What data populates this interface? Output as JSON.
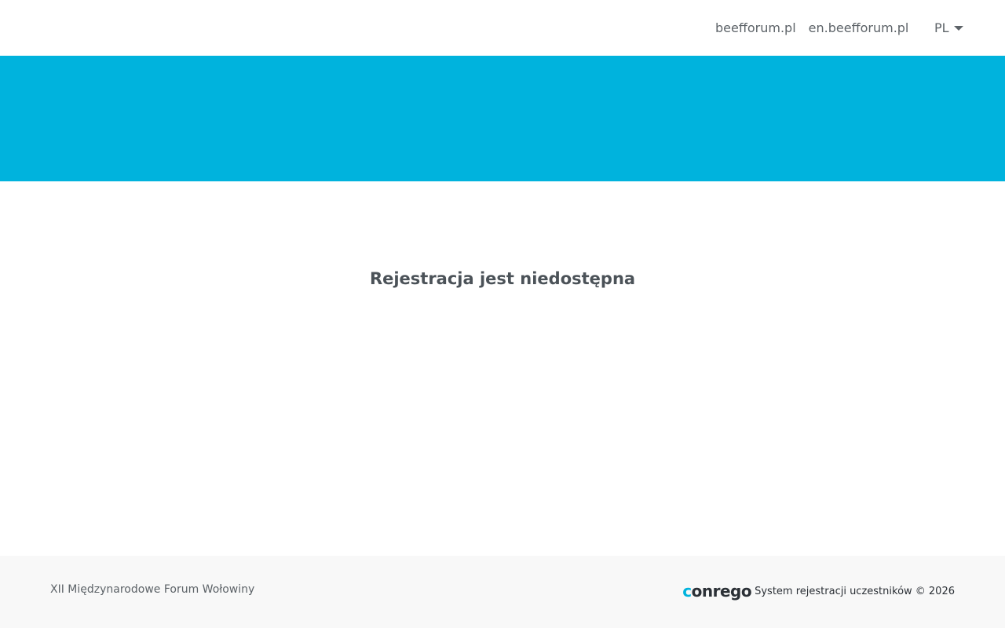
{
  "header": {
    "links": [
      {
        "label": "beefforum.pl"
      },
      {
        "label": "en.beefforum.pl"
      }
    ],
    "language": {
      "selected": "PL"
    }
  },
  "main": {
    "message": "Rejestracja jest niedostępna"
  },
  "footer": {
    "event_name": "XII Międzynarodowe Forum Wołowiny",
    "brand": {
      "logo_text": "conrego",
      "logo_first": "c",
      "logo_rest": "onrego"
    },
    "system_text": "System rejestracji uczestników © 2026"
  },
  "colors": {
    "accent": "#00b3dd",
    "footer_bg": "#f8f8f8",
    "text": "#4b5258"
  }
}
